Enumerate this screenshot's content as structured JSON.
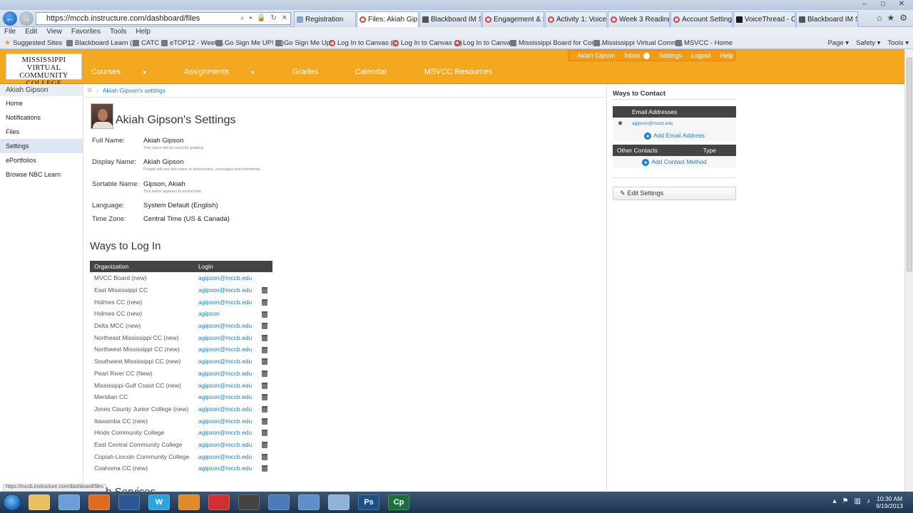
{
  "browser": {
    "address": "https://mccb.instructure.com/dashboard/files",
    "address_icons": "⌕ ▾ 🔒 ↻ ✕",
    "tabs": [
      {
        "label": "Registration",
        "icon": "reg",
        "active": false
      },
      {
        "label": "Files: Akiah Gip...",
        "icon": "canvas",
        "active": true
      },
      {
        "label": "Blackboard IM Sig...",
        "icon": "bb",
        "active": false
      },
      {
        "label": "Engagement & In...",
        "icon": "canvas",
        "active": false
      },
      {
        "label": "Activity 1: Voice T...",
        "icon": "canvas",
        "active": false
      },
      {
        "label": "Week 3 Readings ...",
        "icon": "canvas",
        "active": false
      },
      {
        "label": "Account Settings",
        "icon": "canvas",
        "active": false
      },
      {
        "label": "VoiceThread - Co...",
        "icon": "vt",
        "active": false
      },
      {
        "label": "Blackboard IM Sig...",
        "icon": "bb",
        "active": false
      }
    ],
    "menu": [
      "File",
      "Edit",
      "View",
      "Favorites",
      "Tools",
      "Help"
    ],
    "favorites": [
      {
        "label": "Suggested Sites",
        "icon": "star"
      },
      {
        "label": "Blackboard Learn (2)",
        "icon": "sq"
      },
      {
        "label": "CATC",
        "icon": "sq"
      },
      {
        "label": "eTOP12 - Week 1",
        "icon": "sq"
      },
      {
        "label": "Go Sign Me UP! (2)",
        "icon": "sq"
      },
      {
        "label": "Go Sign Me Up!",
        "icon": "sq"
      },
      {
        "label": "Log In to Canvas (2)",
        "icon": "canvas"
      },
      {
        "label": "Log In to Canvas (3)",
        "icon": "canvas"
      },
      {
        "label": "Log In to Canvas",
        "icon": "canvas"
      },
      {
        "label": "Mississippi Board for Com...",
        "icon": "sq"
      },
      {
        "label": "Mississippi Virtual Comm...",
        "icon": "sq"
      },
      {
        "label": "MSVCC - Home",
        "icon": "sq"
      }
    ],
    "fav_tools": [
      "Page ▾",
      "Safety ▾",
      "Tools ▾"
    ],
    "status_url": "https://mccb.instructure.com/dashboard/files"
  },
  "header": {
    "logo": {
      "line1": "MISSISSIPPI VIRTUAL",
      "line2": "COMMUNITY COLLEGE",
      "line3": "CONNECTING · ENGAGING · EMPOWERING"
    },
    "nav": [
      {
        "label": "Courses",
        "caret": true
      },
      {
        "label": "Assignments",
        "caret": true
      },
      {
        "label": "Grades",
        "caret": false
      },
      {
        "label": "Calendar",
        "caret": false
      },
      {
        "label": "MSVCC Resources",
        "caret": false
      }
    ],
    "user": {
      "name": "Akiah Gipson",
      "inbox": "Inbox",
      "settings": "Settings",
      "logout": "Logout",
      "help": "Help"
    }
  },
  "leftnav": {
    "heading": "Akiah Gipson",
    "items": [
      {
        "label": "Home",
        "active": false
      },
      {
        "label": "Notifications",
        "active": false
      },
      {
        "label": "Files",
        "active": false
      },
      {
        "label": "Settings",
        "active": true
      },
      {
        "label": "ePortfolios",
        "active": false
      },
      {
        "label": "Browse NBC Learn",
        "active": false
      }
    ]
  },
  "breadcrumb": {
    "current": "Akiah Gipson's settings"
  },
  "profile": {
    "title": "Akiah Gipson's Settings",
    "fields": [
      {
        "label": "Full Name:",
        "value": "Akiah Gipson",
        "hint": "This name will be used for grading."
      },
      {
        "label": "Display Name:",
        "value": "Akiah Gipson",
        "hint": "People will see this name in discussions, messages and comments."
      },
      {
        "label": "Sortable Name:",
        "value": "Gipson, Akiah",
        "hint": "This name appears in sorted lists."
      },
      {
        "label": "Language:",
        "value": "System Default (English)",
        "hint": ""
      },
      {
        "label": "Time Zone:",
        "value": "Central Time (US & Canada)",
        "hint": ""
      }
    ]
  },
  "logins": {
    "title": "Ways to Log In",
    "col_org": "Organization",
    "col_login": "Login",
    "rows": [
      {
        "org": "MVCC Board (new)",
        "login": "agipson@mccb.edu",
        "trash": false
      },
      {
        "org": "East Mississippi CC",
        "login": "agipson@mccb.edu",
        "trash": true
      },
      {
        "org": "Holmes CC (new)",
        "login": "agipson@mccb.edu",
        "trash": true
      },
      {
        "org": "Holmes CC (new)",
        "login": "agipson",
        "trash": true
      },
      {
        "org": "Delta MCC (new)",
        "login": "agipson@mccb.edu",
        "trash": true
      },
      {
        "org": "Northeast Mississippi CC (new)",
        "login": "agipson@mccb.edu",
        "trash": true
      },
      {
        "org": "Northwest Mississippi CC (new)",
        "login": "agipson@mccb.edu",
        "trash": true
      },
      {
        "org": "Southwest Mississippi CC (new)",
        "login": "agipson@mccb.edu",
        "trash": true
      },
      {
        "org": "Pearl River CC (New)",
        "login": "agipson@mccb.edu",
        "trash": true
      },
      {
        "org": "Mississippi Gulf Coast CC (new)",
        "login": "agipson@mccb.edu",
        "trash": true
      },
      {
        "org": "Meridian CC",
        "login": "agipson@mccb.edu",
        "trash": true
      },
      {
        "org": "Jones County Junior College (new)",
        "login": "agipson@mccb.edu",
        "trash": true
      },
      {
        "org": "Itawamba CC (new)",
        "login": "agipson@mccb.edu",
        "trash": true
      },
      {
        "org": "Hinds Community College",
        "login": "agipson@mccb.edu",
        "trash": true
      },
      {
        "org": "East Central Community College",
        "login": "agipson@mccb.edu",
        "trash": true
      },
      {
        "org": "Copiah-Lincoln Community College",
        "login": "agipson@mccb.edu",
        "trash": true
      },
      {
        "org": "Coahoma CC (new)",
        "login": "agipson@mccb.edu",
        "trash": true
      }
    ]
  },
  "web_services": {
    "title": "Web Services"
  },
  "contact": {
    "title": "Ways to Contact",
    "email_header": "Email Addresses",
    "email": "agipson@mccb.edu",
    "add_email": "Add Email Address",
    "other_header": "Other Contacts",
    "type_header": "Type",
    "add_contact": "Add Contact Method",
    "edit_settings": "Edit Settings"
  },
  "taskbar": {
    "apps": [
      "",
      "",
      "",
      "",
      "W",
      "",
      "",
      "",
      "",
      "",
      "",
      "Ps",
      "Cp"
    ],
    "time": "10:30 AM",
    "date": "9/19/2013"
  }
}
